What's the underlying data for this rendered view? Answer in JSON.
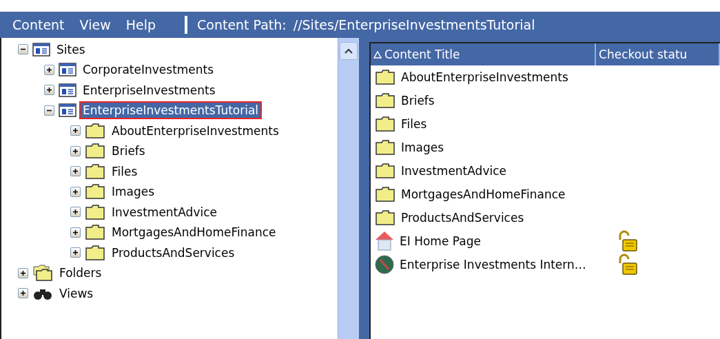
{
  "menu": [
    {
      "label": "Content"
    },
    {
      "label": "View"
    },
    {
      "label": "Help"
    }
  ],
  "content_path": {
    "label": "Content Path:",
    "value": "//Sites/EnterpriseInvestmentsTutorial"
  },
  "tree": [
    {
      "label": "Sites",
      "kind": "sites",
      "expanded": true,
      "selected": false,
      "children": [
        {
          "label": "CorporateInvestments",
          "kind": "site",
          "expanded": false,
          "selected": false
        },
        {
          "label": "EnterpriseInvestments",
          "kind": "site",
          "expanded": false,
          "selected": false
        },
        {
          "label": "EnterpriseInvestmentsTutorial",
          "kind": "site",
          "expanded": true,
          "selected": true,
          "children": [
            {
              "label": "AboutEnterpriseInvestments",
              "kind": "folder",
              "expanded": false,
              "selected": false
            },
            {
              "label": "Briefs",
              "kind": "folder",
              "expanded": false,
              "selected": false
            },
            {
              "label": "Files",
              "kind": "folder",
              "expanded": false,
              "selected": false
            },
            {
              "label": "Images",
              "kind": "folder",
              "expanded": false,
              "selected": false
            },
            {
              "label": "InvestmentAdvice",
              "kind": "folder",
              "expanded": false,
              "selected": false
            },
            {
              "label": "MortgagesAndHomeFinance",
              "kind": "folder",
              "expanded": false,
              "selected": false
            },
            {
              "label": "ProductsAndServices",
              "kind": "folder",
              "expanded": false,
              "selected": false
            }
          ]
        }
      ]
    },
    {
      "label": "Folders",
      "kind": "folders",
      "expanded": false,
      "selected": false
    },
    {
      "label": "Views",
      "kind": "views",
      "expanded": false,
      "selected": false
    }
  ],
  "table": {
    "columns": [
      {
        "label": "Content Title",
        "sorted": true
      },
      {
        "label": "Checkout statu",
        "sorted": false
      }
    ],
    "rows": [
      {
        "title": "AboutEnterpriseInvestments",
        "kind": "folder",
        "unlocked": false
      },
      {
        "title": "Briefs",
        "kind": "folder",
        "unlocked": false
      },
      {
        "title": "Files",
        "kind": "folder",
        "unlocked": false
      },
      {
        "title": "Images",
        "kind": "folder",
        "unlocked": false
      },
      {
        "title": "InvestmentAdvice",
        "kind": "folder",
        "unlocked": false
      },
      {
        "title": "MortgagesAndHomeFinance",
        "kind": "folder",
        "unlocked": false
      },
      {
        "title": "ProductsAndServices",
        "kind": "folder",
        "unlocked": false
      },
      {
        "title": "EI Home Page",
        "kind": "page",
        "unlocked": true
      },
      {
        "title": "Enterprise Investments Intern…",
        "kind": "globe",
        "unlocked": true
      }
    ]
  }
}
